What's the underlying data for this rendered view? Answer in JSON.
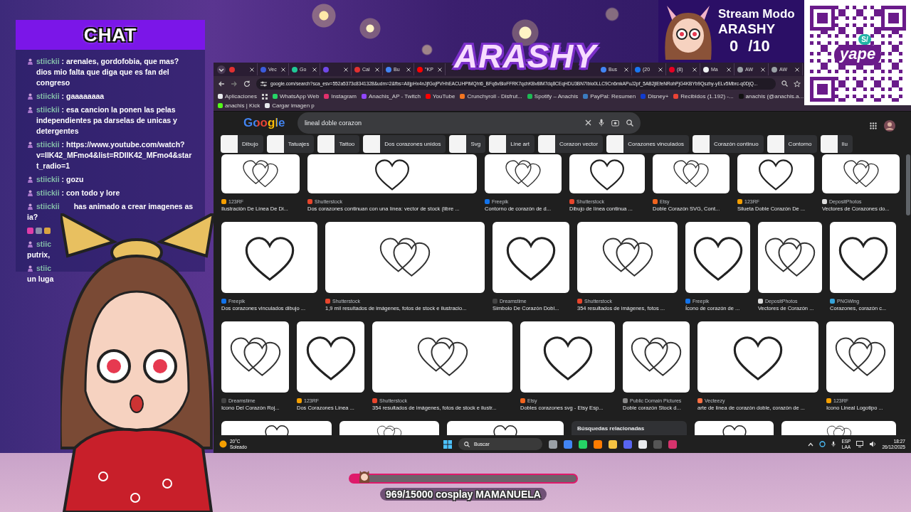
{
  "chat": {
    "title": "CHAT",
    "messages": [
      {
        "kind": "full",
        "user": "stiickii",
        "text": ": arenales, gordofobia, que mas? dios mio falta que diga que es fan del congreso"
      },
      {
        "kind": "full",
        "user": "stiickii",
        "text": ": gaaaaaaaa"
      },
      {
        "kind": "full",
        "user": "stiickii",
        "text": ": esa cancion la ponen las pelas independientes pa darselas de unicas y detergentes"
      },
      {
        "kind": "full",
        "user": "stiickii",
        "text": ": https://www.youtube.com/watch?v=IlK42_MFmo4&list=RDIlK42_MFmo4&start_radio=1"
      },
      {
        "kind": "full",
        "user": "stiickii",
        "text": ": gozu"
      },
      {
        "kind": "full",
        "user": "stiickii",
        "text": ": con todo y lore"
      },
      {
        "kind": "cut",
        "user": "stiickii",
        "text": "has animado a crear imagenes as",
        "next": "ia?"
      },
      {
        "kind": "emotes"
      },
      {
        "kind": "cut",
        "user": "stiic",
        "next": "putrix,"
      },
      {
        "kind": "cut",
        "user": "stiic",
        "next": "un luga"
      }
    ]
  },
  "logo": {
    "text": "ARASHY"
  },
  "stream_panel": {
    "title": "Stream Modo",
    "name": "ARASHY",
    "count": "0",
    "total": "/10"
  },
  "qr": {
    "currency": "S/",
    "brand": "yape"
  },
  "browser": {
    "tabs": [
      {
        "color": "#e03131"
      },
      {
        "label": "Vec",
        "color": "#3b5bdb"
      },
      {
        "label": "Go",
        "color": "#20c997"
      },
      {
        "color": "#7048e8"
      },
      {
        "label": "Cal",
        "color": "#e03131"
      },
      {
        "label": "Bu",
        "color": "#4285f4"
      },
      {
        "label": "\"KP",
        "color": "#ff0000"
      },
      {
        "label": "Bus",
        "color": "#4285f4"
      },
      {
        "label": "(20",
        "color": "#1877f2"
      },
      {
        "label": "(8)",
        "color": "#e60023"
      },
      {
        "label": "Ma",
        "color": "#f1f3f4"
      },
      {
        "label": "AW",
        "color": "#9aa0a6"
      },
      {
        "label": "AW",
        "color": "#9aa0a6"
      }
    ],
    "url": "google.com/search?sca_esv=552a5373c8341328&udm=2&fbs=AIIjpHx4nJjfGojPVHhEACUHPiMQht6_BFq6vBloFFRK7qchKBv8lM7dq8CEqHDU3BN7Ibio0LLC9Cn6mkAPuJ2pf_5AB2jlEfeNRohPjG4KBYb9Qszhy-yELv5Mbrc-q0DjQ...",
    "bookmarks": [
      {
        "label": "Aplicaciones",
        "color": "#e8eaed"
      },
      {
        "label": "WhatsApp Web",
        "color": "#25d366"
      },
      {
        "label": "Instagram",
        "color": "#e1306c"
      },
      {
        "label": "Anachis_AP - Twitch",
        "color": "#9146ff"
      },
      {
        "label": "YouTube",
        "color": "#ff0000"
      },
      {
        "label": "Crunchyroll - Disfrut...",
        "color": "#f47521"
      },
      {
        "label": "Spotify – Anachis",
        "color": "#1db954"
      },
      {
        "label": "PayPal: Resumen",
        "color": "#3b7bbf"
      },
      {
        "label": "Disney+",
        "color": "#113ccf"
      },
      {
        "label": "Recibidos (1.192) -...",
        "color": "#ea4335"
      },
      {
        "label": "anachis (@anachis.a...",
        "color": "#111111"
      },
      {
        "label": "anachis | Kick",
        "color": "#53fc18"
      },
      {
        "label": "Cargar imagen p",
        "color": "#e8eaed"
      }
    ],
    "logo": "Google",
    "query": "lineal doble corazon",
    "chips": [
      "Dibujo",
      "Tatuajes",
      "Tattoo",
      "Dos corazones unidos",
      "Svg",
      "Line art",
      "Corazon vector",
      "Corazones vinculados",
      "Corazón continuo",
      "Contorno",
      "Ilu"
    ],
    "rows": [
      [
        {
          "kind": "image",
          "source": "123RF",
          "color": "#f59f00",
          "title": "Ilustración De Línea De Di..."
        },
        {
          "kind": "image",
          "source": "Shutterstock",
          "color": "#e8452c",
          "title": "Dos corazones continuan con una línea: vector de stock (libre ..."
        },
        {
          "kind": "image",
          "source": "Freepik",
          "color": "#1273eb",
          "title": "Contorno de corazón de d..."
        },
        {
          "kind": "image",
          "source": "Shutterstock",
          "color": "#e8452c",
          "title": "Dibujo de línea continua ..."
        },
        {
          "kind": "image",
          "source": "Etsy",
          "color": "#f1641e",
          "title": "Doble Corazón SVG, Cont..."
        },
        {
          "kind": "image",
          "source": "123RF",
          "color": "#f59f00",
          "title": "Silueta Doble Corazón De ..."
        },
        {
          "kind": "image",
          "source": "DepositPhotos",
          "color": "#dddddd",
          "title": "Vectores de Corazones do..."
        }
      ],
      [
        {
          "kind": "image",
          "source": "Freepik",
          "color": "#1273eb",
          "title": "Dos corazones vinculados dibujo ..."
        },
        {
          "kind": "image",
          "source": "Shutterstock",
          "color": "#e8452c",
          "title": "1,9 mil resultados de imágenes, fotos de stock e ilustracio..."
        },
        {
          "kind": "image",
          "source": "Dreamstime",
          "color": "#444444",
          "title": "Símbolo De Corazón Dobl..."
        },
        {
          "kind": "image",
          "source": "Shutterstock",
          "color": "#e8452c",
          "title": "354 resultados de imágenes, fotos ..."
        },
        {
          "kind": "image",
          "source": "Freepik",
          "color": "#1273eb",
          "title": "Ícono de corazón de ..."
        },
        {
          "kind": "image",
          "source": "DepositPhotos",
          "color": "#dddddd",
          "title": "Vectores de Corazón ..."
        },
        {
          "kind": "image",
          "source": "PNGWing",
          "color": "#36a3d9",
          "title": "Corazones, corazón c..."
        }
      ],
      [
        {
          "kind": "image",
          "source": "Dreamstime",
          "color": "#444444",
          "title": "Icono Del Corazón Roj..."
        },
        {
          "kind": "image",
          "source": "123RF",
          "color": "#f59f00",
          "title": "Dos Corazones Línea ..."
        },
        {
          "kind": "image",
          "source": "Shutterstock",
          "color": "#e8452c",
          "title": "354 resultados de imágenes, fotos de stock e ilustr..."
        },
        {
          "kind": "image",
          "source": "Etsy",
          "color": "#f1641e",
          "title": "Dobles corazones svg - Etsy Esp..."
        },
        {
          "kind": "image",
          "source": "Public Domain Pictures",
          "color": "#888888",
          "title": "Doble corazón Stock d..."
        },
        {
          "kind": "image",
          "source": "Vecteezy",
          "color": "#ff7043",
          "title": "arte de línea de corazón doble, corazón de ..."
        },
        {
          "kind": "image",
          "source": "123RF",
          "color": "#f59f00",
          "title": "Icono Lineal Logotipo ..."
        }
      ],
      [
        {
          "kind": "image"
        },
        {
          "kind": "image"
        },
        {
          "kind": "image"
        },
        {
          "kind": "related",
          "title": "Búsquedas relacionadas"
        },
        {
          "kind": "image"
        },
        {
          "kind": "image"
        }
      ]
    ],
    "taskbar": {
      "temperature": "20°C",
      "weather": "Soleado",
      "search": "Buscar",
      "language": "ESP",
      "layout": "LAA",
      "time": "18:27",
      "date": "26/12/2025"
    }
  },
  "goal": {
    "level": 0.065,
    "label": "969/15000 cosplay MAMANUELA"
  }
}
